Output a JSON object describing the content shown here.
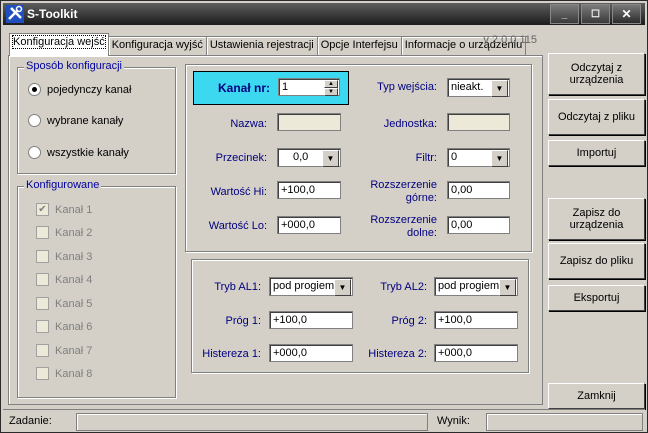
{
  "window": {
    "title": "S-Toolkit"
  },
  "tabs": [
    {
      "label": "Konfiguracja wejść"
    },
    {
      "label": "Konfiguracja wyjść"
    },
    {
      "label": "Ustawienia rejestracji"
    },
    {
      "label": "Opcje Interfejsu"
    },
    {
      "label": "Informacje o urządzeniu"
    }
  ],
  "version": "v 2.0.0.115",
  "config_mode": {
    "title": "Sposób konfiguracji",
    "options": [
      "pojedynczy kanał",
      "wybrane kanały",
      "wszystkie kanały"
    ],
    "selected": "pojedynczy kanał"
  },
  "configured": {
    "title": "Konfigurowane",
    "channels": [
      "Kanał 1",
      "Kanał 2",
      "Kanał 3",
      "Kanał 4",
      "Kanał 5",
      "Kanał 6",
      "Kanał 7",
      "Kanał 8"
    ],
    "checked": [
      "Kanał 1"
    ]
  },
  "channel": {
    "label": "Kanał nr:",
    "value": "1"
  },
  "fields": {
    "input_type": {
      "label": "Typ wejścia:",
      "value": "nieakt."
    },
    "name": {
      "label": "Nazwa:",
      "value": ""
    },
    "unit": {
      "label": "Jednostka:",
      "value": ""
    },
    "decimal": {
      "label": "Przecinek:",
      "value": "0,0"
    },
    "filter": {
      "label": "Filtr:",
      "value": "0"
    },
    "val_hi": {
      "label": "Wartość Hi:",
      "value": "+100,0"
    },
    "ext_top": {
      "label_1": "Rozszerzenie",
      "label_2": "górne:",
      "value": "0,00"
    },
    "val_lo": {
      "label": "Wartość Lo:",
      "value": "+000,0"
    },
    "ext_bottom": {
      "label_1": "Rozszerzenie",
      "label_2": "dolne:",
      "value": "0,00"
    }
  },
  "alarms": {
    "al1_mode": {
      "label": "Tryb AL1:",
      "value": "pod progiem"
    },
    "al2_mode": {
      "label": "Tryb AL2:",
      "value": "pod progiem"
    },
    "threshold1": {
      "label": "Próg 1:",
      "value": "+100,0"
    },
    "threshold2": {
      "label": "Próg 2:",
      "value": "+100,0"
    },
    "hyst1": {
      "label": "Histereza 1:",
      "value": "+000,0"
    },
    "hyst2": {
      "label": "Histereza 2:",
      "value": "+000,0"
    }
  },
  "buttons": {
    "read_device_1": "Odczytaj z",
    "read_device_2": "urządzenia",
    "read_file": "Odczytaj z pliku",
    "import": "Importuj",
    "save_device_1": "Zapisz do",
    "save_device_2": "urządzenia",
    "save_file": "Zapisz do pliku",
    "export": "Eksportuj",
    "close": "Zamknij"
  },
  "status": {
    "task_label": "Zadanie:",
    "task_value": "",
    "result_label": "Wynik:",
    "result_value": ""
  },
  "colors": {
    "channel_highlight": "#3bd8f0",
    "label_blue": "#000080"
  }
}
